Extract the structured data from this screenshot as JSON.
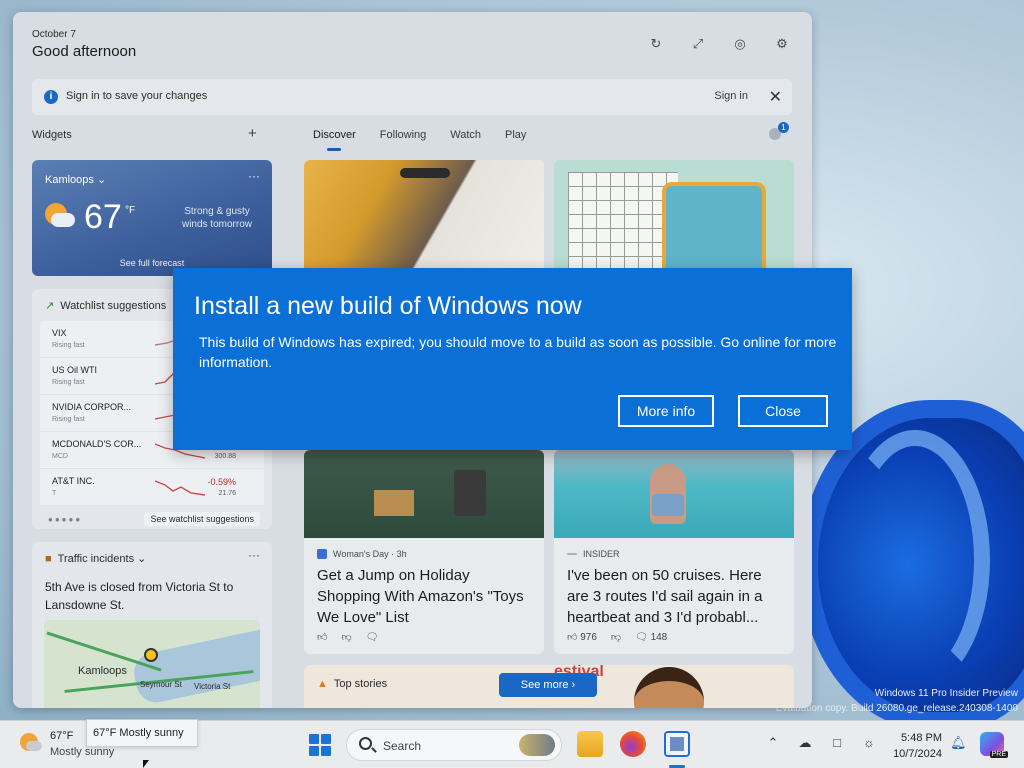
{
  "board": {
    "date": "October 7",
    "greeting": "Good afternoon",
    "signin_banner": {
      "text": "Sign in to save your changes",
      "link": "Sign in"
    },
    "widgets_label": "Widgets",
    "tabs": [
      "Discover",
      "Following",
      "Watch",
      "Play"
    ],
    "profile_badge": "1"
  },
  "weather": {
    "city": "Kamloops",
    "temp": "67",
    "unit": "°F",
    "desc": "Strong & gusty winds tomorrow",
    "footer": "See full forecast"
  },
  "watchlist": {
    "title": "Watchlist suggestions",
    "rows": [
      {
        "name": "VIX",
        "sub": "Rising fast",
        "pct": "",
        "price": ""
      },
      {
        "name": "US Oil WTI",
        "sub": "Rising fast",
        "pct": "",
        "price": ""
      },
      {
        "name": "NVIDIA CORPOR...",
        "sub": "Rising fast",
        "pct": "",
        "price": ""
      },
      {
        "name": "MCDONALD'S COR...",
        "sub": "MCD",
        "pct": "",
        "price": "300.88"
      },
      {
        "name": "AT&T INC.",
        "sub": "T",
        "pct": "-0.59%",
        "price": "21.76"
      }
    ],
    "link": "See watchlist suggestions"
  },
  "traffic": {
    "title": "Traffic incidents",
    "desc": "5th Ave is closed from Victoria St to Lansdowne St.",
    "map_labels": [
      "Kamloops",
      "Seymour St",
      "Victoria St"
    ]
  },
  "cards": [
    {
      "source": "Woman's Day · 3h",
      "headline": "Get a Jump on Holiday Shopping With Amazon's \"Toys We Love\" List",
      "likes": "",
      "comments": ""
    },
    {
      "source": "INSIDER",
      "headline": "I've been on 50 cruises. Here are 3 routes I'd sail again in a heartbeat and 3 I'd probabl...",
      "likes": "976",
      "comments": "148"
    }
  ],
  "top_stories": {
    "label": "Top stories",
    "button": "See more",
    "promo": "estival"
  },
  "dialog": {
    "title": "Install a new build of Windows now",
    "body": "This build of Windows has expired; you should move to a build as soon as possible. Go online for more information.",
    "more_info": "More info",
    "close": "Close"
  },
  "watermark": {
    "line1": "Windows 11 Pro Insider Preview",
    "line2": "Evaluation copy. Build 26080.ge_release.240308-1400"
  },
  "taskbar": {
    "weather_temp": "67°F",
    "weather_cond": "Mostly sunny",
    "tooltip": "67°F Mostly sunny",
    "search_label": "Search",
    "time": "5:48 PM",
    "date": "10/7/2024",
    "copilot_badge": "PRE"
  },
  "colors": {
    "dialog_bg": "#0a6fd6",
    "accent": "#1a67c4"
  }
}
